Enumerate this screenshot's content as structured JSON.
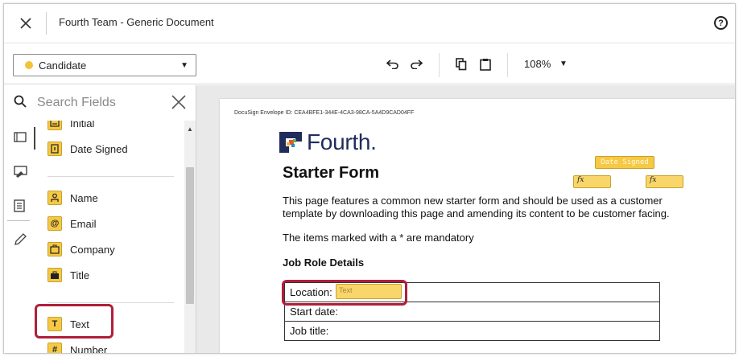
{
  "header": {
    "title": "Fourth Team - Generic Document",
    "close_icon": "close-icon",
    "help_icon": "help-icon",
    "help_glyph": "?"
  },
  "toolbar": {
    "recipient": "Candidate",
    "recipient_color": "#f1c43b",
    "zoom": "108%"
  },
  "search": {
    "placeholder": "Search Fields"
  },
  "rail": {
    "icons": [
      "standard-fields-icon",
      "signature-fields-icon",
      "document-fields-icon",
      "edit-pen-icon"
    ]
  },
  "fields": {
    "group1": [
      {
        "label": "Initial",
        "icon": "initial-icon"
      },
      {
        "label": "Date Signed",
        "icon": "date-icon"
      }
    ],
    "group2": [
      {
        "label": "Name",
        "icon": "person-icon"
      },
      {
        "label": "Email",
        "icon": "at-icon"
      },
      {
        "label": "Company",
        "icon": "building-icon"
      },
      {
        "label": "Title",
        "icon": "briefcase-icon"
      }
    ],
    "group3": [
      {
        "label": "Text",
        "icon": "text-icon",
        "glyph": "T"
      },
      {
        "label": "Number",
        "icon": "hash-icon",
        "glyph": "#"
      }
    ]
  },
  "document": {
    "envelope_id": "DocuSign Envelope ID: CEA4BFE1-344E-4CA3-98CA-5A4D9CAD04FF",
    "logo_text": "Fourth",
    "logo_period": ".",
    "heading": "Starter Form",
    "intro": "This page features a common new starter form and should be used as a customer template by downloading this page and amending its content to be customer facing.",
    "mandatory_note": "The items marked with a * are mandatory",
    "section_heading": "Job Role Details",
    "rows": [
      "Location:",
      "Start date:",
      "Job title:"
    ],
    "date_signed_tag": "Date Signed",
    "formula_tag": "fx",
    "location_field_placeholder": "Text",
    "accent_color": "#b01f3a",
    "tag_color": "#f6c945",
    "logo_color": "#1f2c5c"
  }
}
